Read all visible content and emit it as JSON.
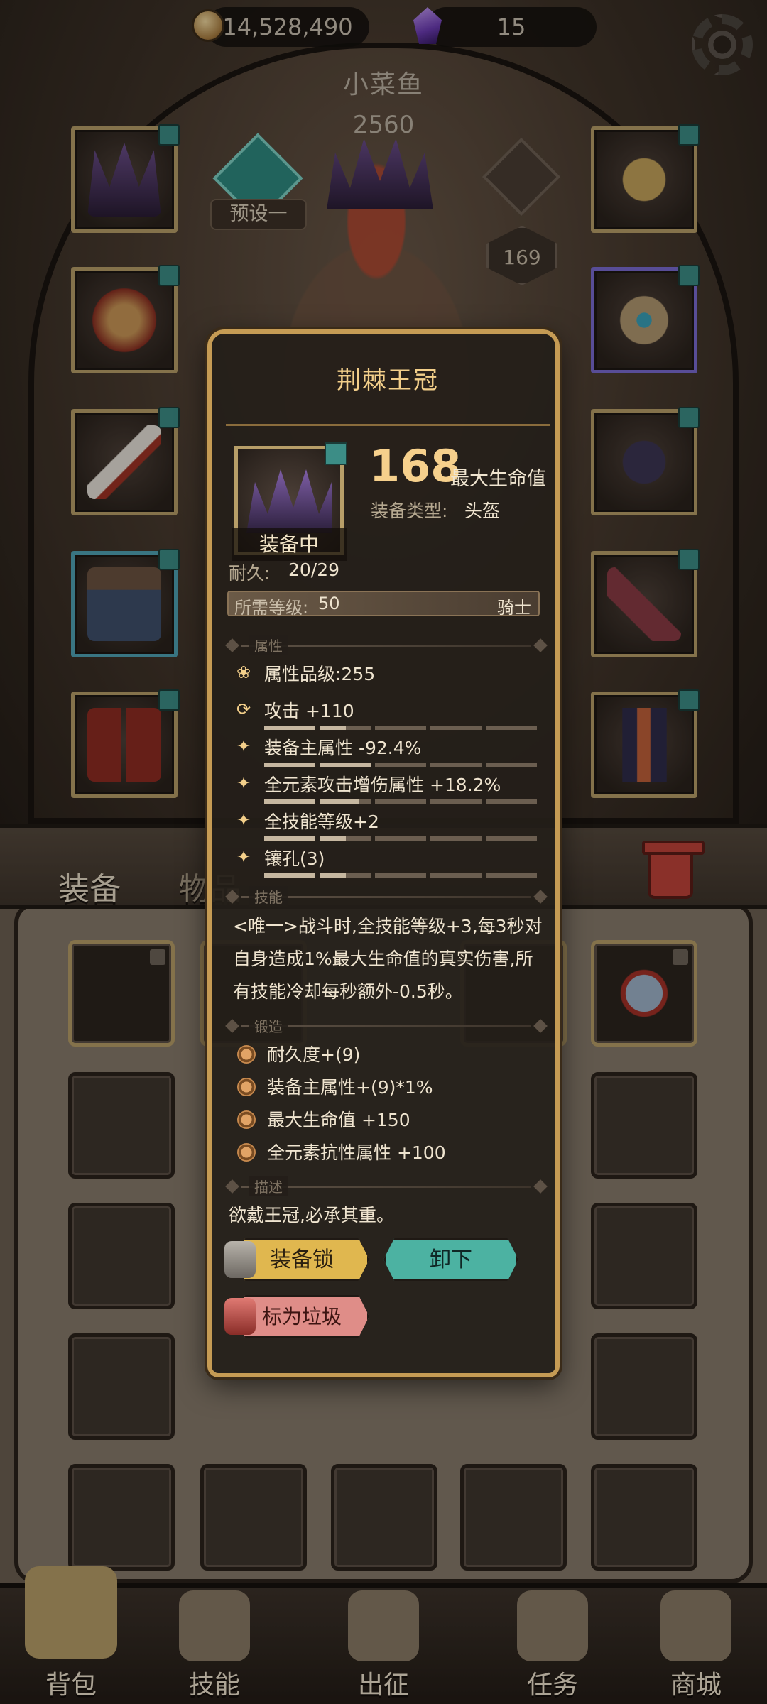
{
  "currency": {
    "gold": "14,528,490",
    "gems": "15"
  },
  "hero": {
    "name": "小菜鱼",
    "power": "2560",
    "preset_label": "预设一",
    "level": "169"
  },
  "tabs": {
    "equip": "装备",
    "items": "物品"
  },
  "nav": [
    {
      "label": "背包",
      "icon": "backpack-icon"
    },
    {
      "label": "技能",
      "icon": "skill-book-icon"
    },
    {
      "label": "出征",
      "icon": "battle-map-icon"
    },
    {
      "label": "任务",
      "icon": "quest-scroll-icon"
    },
    {
      "label": "商城",
      "icon": "shop-emblem-icon"
    }
  ],
  "item": {
    "name": "荆棘王冠",
    "equipped_label": "装备中",
    "main_stat_value": "168",
    "main_stat_label": "最大生命值",
    "type_key": "装备类型:",
    "type_value": "头盔",
    "durability_key": "耐久:",
    "durability_value": "20/29",
    "req_level_key": "所需等级:",
    "req_level_value": "50",
    "req_class": "骑士",
    "sections": {
      "attributes": "属性",
      "skill": "技能",
      "forge": "锻造",
      "description": "描述"
    },
    "attributes": [
      {
        "text": "属性品级:255",
        "icon": "lotus-icon",
        "fill": 1.0,
        "bar": false
      },
      {
        "text": "攻击 +110",
        "icon": "refresh-icon",
        "fill": 0.3,
        "bar": true
      },
      {
        "text": "装备主属性 -92.4%",
        "icon": "star-icon",
        "fill": 0.4,
        "bar": true
      },
      {
        "text": "全元素攻击增伤属性 +18.2%",
        "icon": "star-icon",
        "fill": 0.35,
        "bar": true
      },
      {
        "text": "全技能等级+2",
        "icon": "star-icon",
        "fill": 0.3,
        "bar": true
      },
      {
        "text": "镶孔(3)",
        "icon": "star-icon",
        "fill": 0.3,
        "bar": true
      }
    ],
    "skill_text": "<唯一>战斗时,全技能等级+3,每3秒对自身造成1%最大生命值的真实伤害,所有技能冷却每秒额外-0.5秒。",
    "forge": [
      "耐久度+(9)",
      "装备主属性+(9)*1%",
      "最大生命值 +150",
      "全元素抗性属性 +100"
    ],
    "description": "欲戴王冠,必承其重。",
    "buttons": {
      "lock": "装备锁",
      "unequip": "卸下",
      "junk": "标为垃圾"
    }
  },
  "colors": {
    "accent_gold": "#f3cf8a",
    "frame_gold": "#c59b54",
    "button_lock": "#e0b74f",
    "button_unequip": "#4cb2a2",
    "button_junk": "#df8d88"
  }
}
